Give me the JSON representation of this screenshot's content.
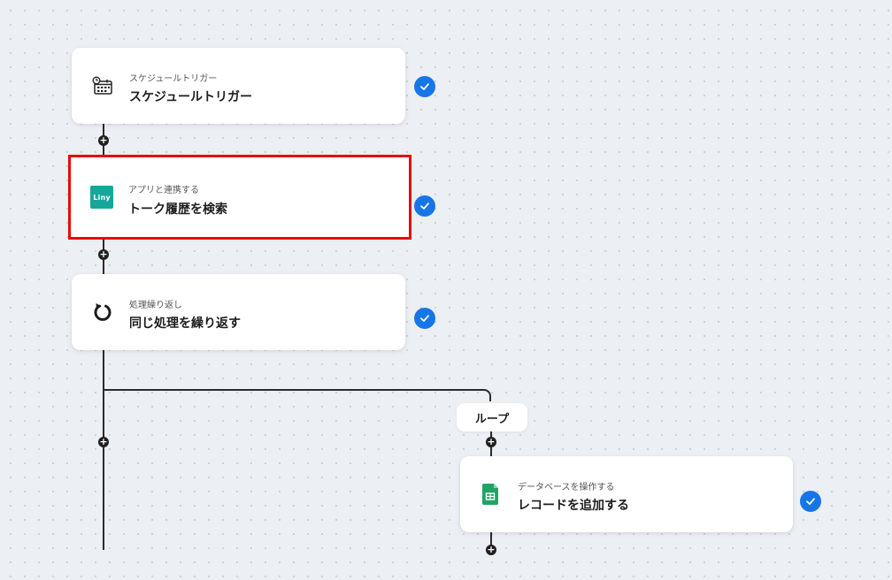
{
  "flow": {
    "steps": [
      {
        "subtitle": "スケジュールトリガー",
        "title": "スケジュールトリガー",
        "icon": "calendar-clock-icon",
        "status": "completed"
      },
      {
        "subtitle": "アプリと連携する",
        "title": "トーク履歴を検索",
        "icon": "liny-app-icon",
        "logo_text": "Liny",
        "logo_color": "#16a79a",
        "status": "completed",
        "selected": true
      },
      {
        "subtitle": "処理繰り返し",
        "title": "同じ処理を繰り返す",
        "icon": "loop-arrow-icon",
        "status": "completed"
      }
    ],
    "branch": {
      "label": "ループ",
      "steps": [
        {
          "subtitle": "データベースを操作する",
          "title": "レコードを追加する",
          "icon": "google-sheets-icon",
          "status": "completed"
        }
      ]
    },
    "add_button_symbol": "+",
    "colors": {
      "background": "#eceff3",
      "connector": "#2b2b2b",
      "check_badge": "#1676e8",
      "selected_outline": "#e50c0c",
      "sheets_green": "#20a464"
    }
  }
}
